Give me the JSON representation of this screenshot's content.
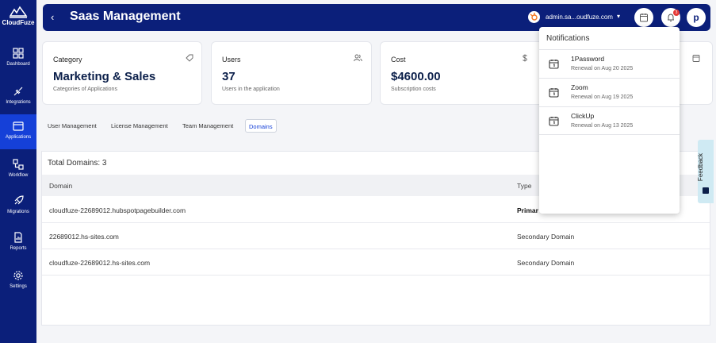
{
  "app": {
    "logo_text": "CloudFuze"
  },
  "sidebar": {
    "items": [
      {
        "label": "Dashboard",
        "icon": "grid-icon"
      },
      {
        "label": "Integrations",
        "icon": "plug-icon"
      },
      {
        "label": "Applications",
        "icon": "window-icon",
        "active": true
      },
      {
        "label": "Workflow",
        "icon": "workflow-icon"
      },
      {
        "label": "Migrations",
        "icon": "rocket-icon"
      },
      {
        "label": "Reports",
        "icon": "report-icon"
      },
      {
        "label": "Settings",
        "icon": "gear-icon"
      }
    ]
  },
  "header": {
    "back": "‹",
    "title": "Saas Management",
    "account": "admin.sa...oudfuze.com",
    "caret": "▾",
    "notif_count": "3",
    "avatar": "p"
  },
  "cards": [
    {
      "label": "Category",
      "value": "Marketing & Sales",
      "sub": "Categories of Applications"
    },
    {
      "label": "Users",
      "value": "37",
      "sub": "Users in the application"
    },
    {
      "label": "Cost",
      "value": "$4600.00",
      "sub": "Subscription costs"
    }
  ],
  "tabs": [
    "User Management",
    "License Management",
    "Team Management",
    "Domains"
  ],
  "active_tab": "Domains",
  "table": {
    "total": "Total Domains: 3",
    "headers": [
      "Domain",
      "Type"
    ],
    "rows": [
      {
        "domain": "cloudfuze-22689012.hubspotpagebuilder.com",
        "type": "Primar"
      },
      {
        "domain": "22689012.hs-sites.com",
        "type": "Secondary Domain"
      },
      {
        "domain": "cloudfuze-22689012.hs-sites.com",
        "type": "Secondary Domain"
      }
    ]
  },
  "notifications": {
    "title": "Notifications",
    "items": [
      {
        "name": "1Password",
        "sub": "Renewal on Aug 20 2025"
      },
      {
        "name": "Zoom",
        "sub": "Renewal on Aug 19 2025"
      },
      {
        "name": "ClickUp",
        "sub": "Renewal on Aug 13 2025"
      }
    ]
  },
  "feedback": {
    "label": "Feedback"
  },
  "colors": {
    "navy": "#0b1f7a",
    "active": "#1540d8",
    "badge": "#e53935",
    "feedback_bg": "#cfeaf3"
  }
}
